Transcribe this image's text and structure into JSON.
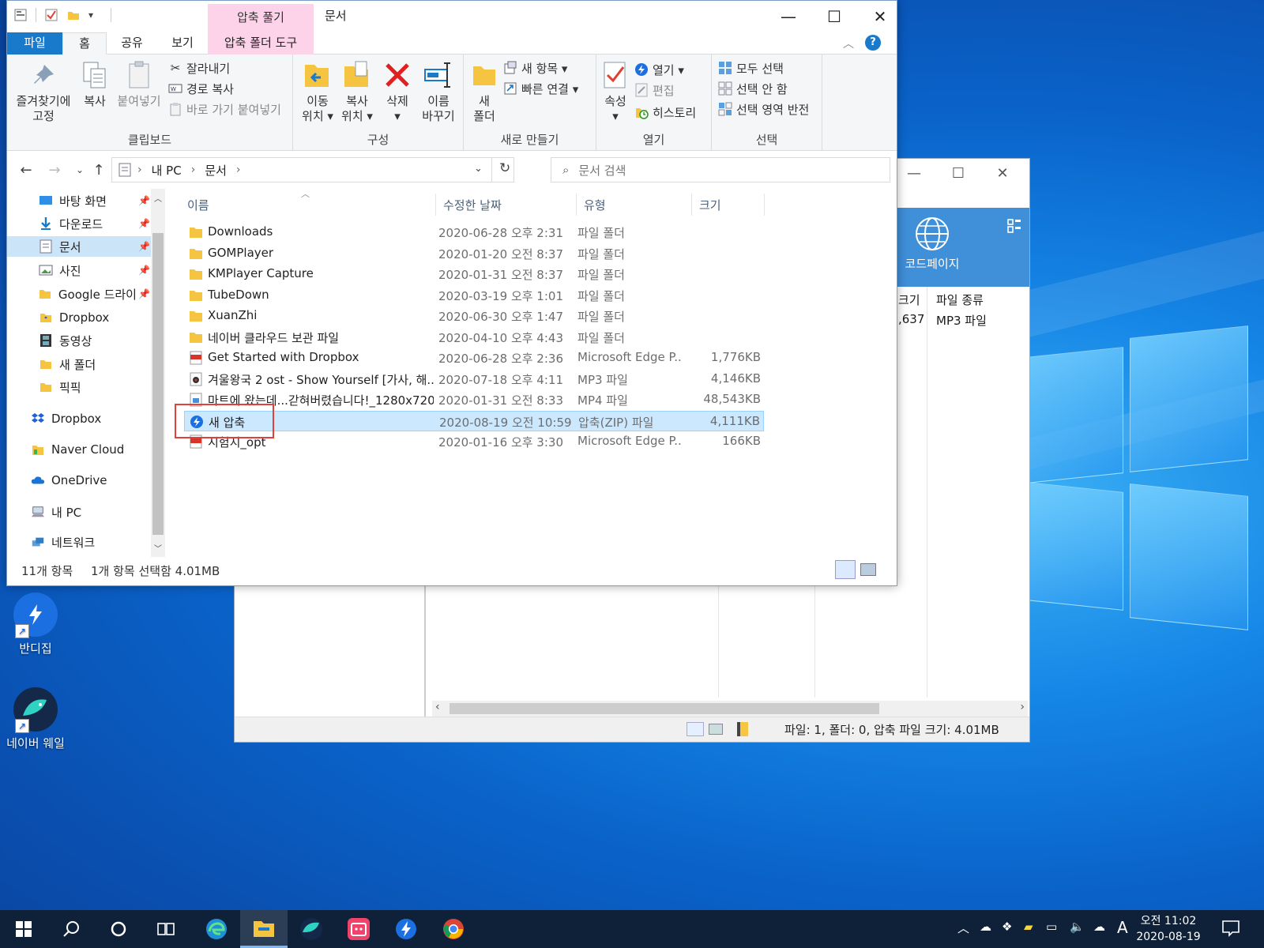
{
  "desktop": {
    "icons": [
      {
        "label": "반디집"
      },
      {
        "label": "네이버 웨일"
      }
    ]
  },
  "bandizip": {
    "codepage_label": "코드페이지",
    "columns": {
      "size": "크기",
      "type": "파일 종류"
    },
    "row": {
      "size_partial": ",637",
      "type": "MP3 파일"
    },
    "status": "파일: 1, 폴더: 0, 압축 파일 크기: 4.01MB"
  },
  "explorer": {
    "title": "문서",
    "context_tab_header": "압축 풀기",
    "tabs": {
      "file": "파일",
      "home": "홈",
      "share": "공유",
      "view": "보기",
      "compressed_tools": "압축 폴더 도구"
    },
    "ribbon": {
      "clipboard": {
        "label": "클립보드",
        "pin": "즐겨찾기에\n고정",
        "copy": "복사",
        "paste": "붙여넣기",
        "cut": "잘라내기",
        "copy_path": "경로 복사",
        "paste_shortcut": "바로 가기 붙여넣기"
      },
      "organize": {
        "label": "구성",
        "move_to_1": "이동",
        "move_to_2": "위치 ▾",
        "copy_to_1": "복사",
        "copy_to_2": "위치 ▾",
        "delete_1": "삭제",
        "delete_2": "▾",
        "rename_1": "이름",
        "rename_2": "바꾸기"
      },
      "new": {
        "label": "새로 만들기",
        "new_folder_1": "새",
        "new_folder_2": "폴더",
        "new_item": "새 항목 ▾",
        "easy_access": "빠른 연결 ▾"
      },
      "open": {
        "label": "열기",
        "properties_1": "속성",
        "properties_2": "▾",
        "open": "열기 ▾",
        "edit": "편집",
        "history": "히스토리"
      },
      "select": {
        "label": "선택",
        "select_all": "모두 선택",
        "select_none": "선택 안 함",
        "invert": "선택 영역 반전"
      }
    },
    "address": {
      "crumbs": [
        "내 PC",
        "문서"
      ]
    },
    "search_placeholder": "문서 검색",
    "nav": [
      {
        "label": "바탕 화면",
        "pinned": true
      },
      {
        "label": "다운로드",
        "pinned": true
      },
      {
        "label": "문서",
        "pinned": true
      },
      {
        "label": "사진",
        "pinned": true
      },
      {
        "label": "Google 드라이",
        "pinned": true
      },
      {
        "label": "Dropbox"
      },
      {
        "label": "동영상"
      },
      {
        "label": "새 폴더"
      },
      {
        "label": "픽픽"
      },
      {
        "label": "Dropbox"
      },
      {
        "label": "Naver Cloud"
      },
      {
        "label": "OneDrive"
      },
      {
        "label": "내 PC"
      },
      {
        "label": "네트워크"
      }
    ],
    "columns": {
      "name": "이름",
      "modified": "수정한 날짜",
      "type": "유형",
      "size": "크기"
    },
    "files": [
      {
        "name": "Downloads",
        "date": "2020-06-28 오후 2:31",
        "type": "파일 폴더",
        "size": "",
        "icon": "folder"
      },
      {
        "name": "GOMPlayer",
        "date": "2020-01-20 오전 8:37",
        "type": "파일 폴더",
        "size": "",
        "icon": "folder"
      },
      {
        "name": "KMPlayer Capture",
        "date": "2020-01-31 오전 8:37",
        "type": "파일 폴더",
        "size": "",
        "icon": "folder"
      },
      {
        "name": "TubeDown",
        "date": "2020-03-19 오후 1:01",
        "type": "파일 폴더",
        "size": "",
        "icon": "folder"
      },
      {
        "name": "XuanZhi",
        "date": "2020-06-30 오후 1:47",
        "type": "파일 폴더",
        "size": "",
        "icon": "folder"
      },
      {
        "name": "네이버 클라우드 보관 파일",
        "date": "2020-04-10 오후 4:43",
        "type": "파일 폴더",
        "size": "",
        "icon": "folder"
      },
      {
        "name": "Get Started with Dropbox",
        "date": "2020-06-28 오후 2:36",
        "type": "Microsoft Edge P...",
        "size": "1,776KB",
        "icon": "pdf"
      },
      {
        "name": "겨울왕국 2 ost - Show Yourself [가사, 해...",
        "date": "2020-07-18 오후 4:11",
        "type": "MP3 파일",
        "size": "4,146KB",
        "icon": "mp3"
      },
      {
        "name": "마트에 왔는데...갇혀버렸습니다!_1280x720",
        "date": "2020-01-31 오전 8:33",
        "type": "MP4 파일",
        "size": "48,543KB",
        "icon": "mp4"
      },
      {
        "name": "새 압축",
        "date": "2020-08-19 오전 10:59",
        "type": "압축(ZIP) 파일",
        "size": "4,111KB",
        "icon": "zip",
        "selected": true
      },
      {
        "name": "시험지_opt",
        "date": "2020-01-16 오후 3:30",
        "type": "Microsoft Edge P...",
        "size": "166KB",
        "icon": "pdf"
      }
    ],
    "status": {
      "count": "11개 항목",
      "selection": "1개 항목 선택함 4.01MB"
    }
  },
  "taskbar": {
    "clock_time": "오전 11:02",
    "clock_date": "2020-08-19",
    "ime": "A"
  },
  "colors": {
    "accent": "#1979ca",
    "selection": "#cce8ff",
    "context_tab": "#fcd3e8",
    "highlight": "#e0413c",
    "taskbar": "#0f2138"
  }
}
